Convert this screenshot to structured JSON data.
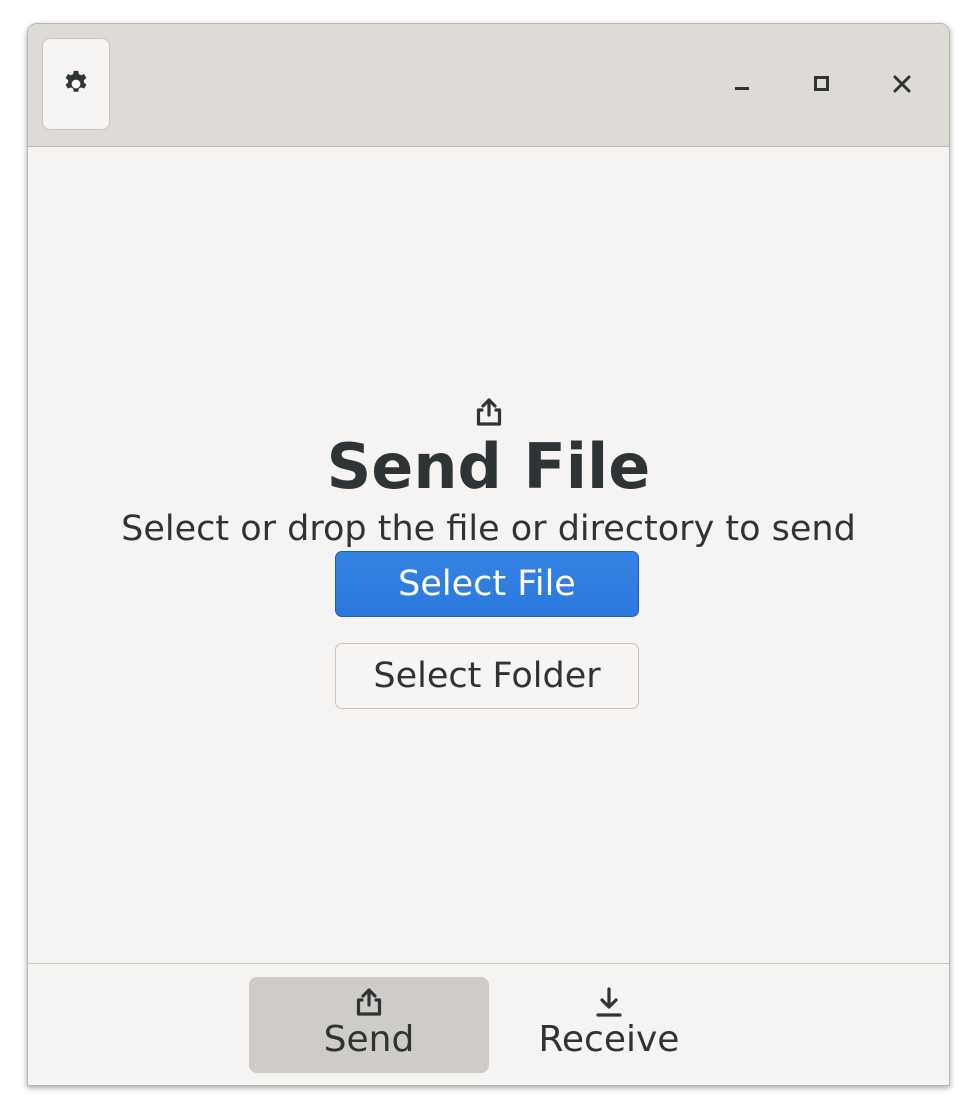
{
  "header": {
    "settings_icon": "gear-icon",
    "window_controls": {
      "minimize_icon": "minimize-icon",
      "maximize_icon": "maximize-icon",
      "close_icon": "close-icon"
    }
  },
  "main": {
    "icon": "upload-icon",
    "title": "Send File",
    "description": "Select or drop the file or directory to send",
    "select_file_label": "Select File",
    "select_folder_label": "Select Folder"
  },
  "view_switcher": {
    "items": [
      {
        "label": "Send",
        "icon": "upload-icon",
        "active": true
      },
      {
        "label": "Receive",
        "icon": "download-icon",
        "active": false
      }
    ]
  },
  "colors": {
    "accent": "#3584e4",
    "text": "#2e3436",
    "header_bg": "#dedad6",
    "window_bg": "#f5f4f2",
    "active_tab_bg": "#cfcbc7"
  }
}
